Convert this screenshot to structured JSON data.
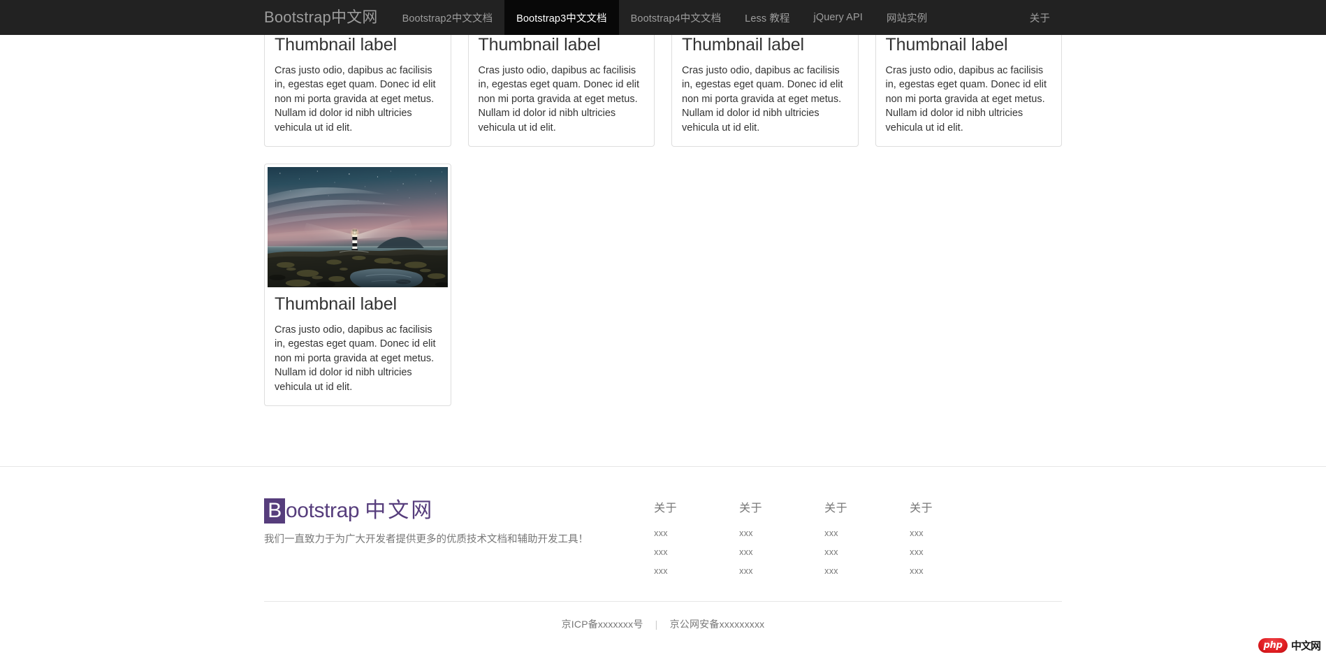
{
  "navbar": {
    "brand": "Bootstrap中文网",
    "items": [
      {
        "label": "Bootstrap2中文文档",
        "active": false
      },
      {
        "label": "Bootstrap3中文文档",
        "active": true
      },
      {
        "label": "Bootstrap4中文文档",
        "active": false
      },
      {
        "label": "Less 教程",
        "active": false
      },
      {
        "label": "jQuery API",
        "active": false
      },
      {
        "label": "网站实例",
        "active": false
      }
    ],
    "right_items": [
      {
        "label": "关于"
      }
    ],
    "background_color": "#222222",
    "active_background_color": "#080808",
    "link_color": "#9d9d9d",
    "active_link_color": "#ffffff"
  },
  "main": {
    "thumbnails": [
      {
        "title": "Thumbnail label",
        "text": "Cras justo odio, dapibus ac facilisis in, egestas eget quam. Donec id elit non mi porta gravida at eget metus. Nullam id dolor id nibh ultricies vehicula ut id elit.",
        "image_alt": "lighthouse-night-seascape"
      },
      {
        "title": "Thumbnail label",
        "text": "Cras justo odio, dapibus ac facilisis in, egestas eget quam. Donec id elit non mi porta gravida at eget metus. Nullam id dolor id nibh ultricies vehicula ut id elit.",
        "image_alt": "lighthouse-night-seascape"
      },
      {
        "title": "Thumbnail label",
        "text": "Cras justo odio, dapibus ac facilisis in, egestas eget quam. Donec id elit non mi porta gravida at eget metus. Nullam id dolor id nibh ultricies vehicula ut id elit.",
        "image_alt": "lighthouse-night-seascape"
      },
      {
        "title": "Thumbnail label",
        "text": "Cras justo odio, dapibus ac facilisis in, egestas eget quam. Donec id elit non mi porta gravida at eget metus. Nullam id dolor id nibh ultricies vehicula ut id elit.",
        "image_alt": "lighthouse-night-seascape"
      },
      {
        "title": "Thumbnail label",
        "text": "Cras justo odio, dapibus ac facilisis in, egestas eget quam. Donec id elit non mi porta gravida at eget metus. Nullam id dolor id nibh ultricies vehicula ut id elit.",
        "image_alt": "lighthouse-night-seascape"
      }
    ]
  },
  "footer": {
    "brand": {
      "initial": "B",
      "rest": "ootstrap",
      "cn": "中文网",
      "color": "#563d7c"
    },
    "tagline": "我们一直致力于为广大开发者提供更多的优质技术文档和辅助开发工具！",
    "columns": [
      {
        "heading": "关于",
        "links": [
          "xxx",
          "xxx",
          "xxx"
        ]
      },
      {
        "heading": "关于",
        "links": [
          "xxx",
          "xxx",
          "xxx"
        ]
      },
      {
        "heading": "关于",
        "links": [
          "xxx",
          "xxx",
          "xxx"
        ]
      },
      {
        "heading": "关于",
        "links": [
          "xxx",
          "xxx",
          "xxx"
        ]
      }
    ],
    "icp": "京ICP备xxxxxxx号",
    "separator": "|",
    "police": "京公网安备xxxxxxxxx"
  },
  "watermark": {
    "badge": "php",
    "text": "中文网"
  }
}
